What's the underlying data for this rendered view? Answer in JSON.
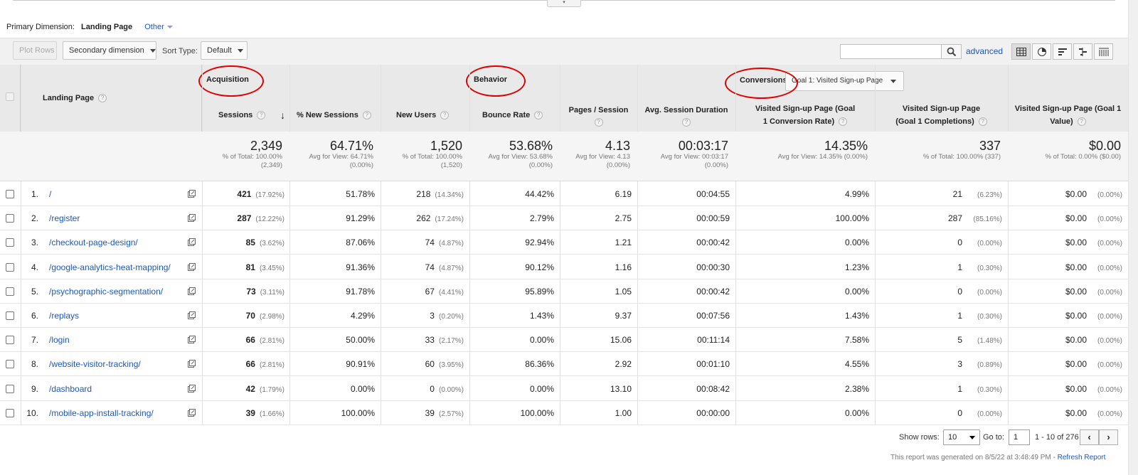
{
  "primary_dimension": {
    "label": "Primary Dimension:",
    "value": "Landing Page",
    "other": "Other"
  },
  "toolbar": {
    "plot_rows": "Plot Rows",
    "secondary_dimension": "Secondary dimension",
    "sort_type_label": "Sort Type:",
    "sort_type_value": "Default",
    "search_value": "",
    "advanced": "advanced"
  },
  "view_icons": [
    "grid-view-icon",
    "pie-view-icon",
    "bar-view-icon",
    "comparison-view-icon",
    "pivot-view-icon"
  ],
  "header": {
    "landing_page": "Landing Page",
    "groups": {
      "acquisition": "Acquisition",
      "behavior": "Behavior",
      "conversions": "Conversions",
      "goal_select": "Goal 1: Visited Sign-up Page"
    },
    "columns": {
      "sessions": "Sessions",
      "new_sessions": "% New Sessions",
      "new_users": "New Users",
      "bounce_rate": "Bounce Rate",
      "pages_session": "Pages / Session",
      "avg_duration": "Avg. Session Duration",
      "conv_rate": "Visited Sign-up Page (Goal 1 Conversion Rate)",
      "completions": "Visited Sign-up Page (Goal 1 Completions)",
      "value": "Visited Sign-up Page (Goal 1 Value)"
    }
  },
  "totals": {
    "sessions": {
      "big": "2,349",
      "sub1": "% of Total: 100.00%",
      "sub2": "(2,349)"
    },
    "new_sessions": {
      "big": "64.71%",
      "sub1": "Avg for View: 64.71%",
      "sub2": "(0.00%)"
    },
    "new_users": {
      "big": "1,520",
      "sub1": "% of Total: 100.00%",
      "sub2": "(1,520)"
    },
    "bounce_rate": {
      "big": "53.68%",
      "sub1": "Avg for View: 53.68%",
      "sub2": "(0.00%)"
    },
    "pages_session": {
      "big": "4.13",
      "sub1": "Avg for View: 4.13",
      "sub2": "(0.00%)"
    },
    "avg_duration": {
      "big": "00:03:17",
      "sub1": "Avg for View: 00:03:17",
      "sub2": "(0.00%)"
    },
    "conv_rate": {
      "big": "14.35%",
      "sub1": "Avg for View: 14.35% (0.00%)",
      "sub2": ""
    },
    "completions": {
      "big": "337",
      "sub1": "% of Total: 100.00% (337)",
      "sub2": ""
    },
    "value": {
      "big": "$0.00",
      "sub1": "% of Total: 0.00% ($0.00)",
      "sub2": ""
    }
  },
  "rows": [
    {
      "index": "1.",
      "page": "/",
      "sessions": "421",
      "sessions_pct": "(17.92%)",
      "new_sessions": "51.78%",
      "new_users": "218",
      "new_users_pct": "(14.34%)",
      "bounce": "44.42%",
      "pages": "6.19",
      "duration": "00:04:55",
      "conv_rate": "4.99%",
      "completions": "21",
      "completions_pct": "(6.23%)",
      "value": "$0.00",
      "value_pct": "(0.00%)"
    },
    {
      "index": "2.",
      "page": "/register",
      "sessions": "287",
      "sessions_pct": "(12.22%)",
      "new_sessions": "91.29%",
      "new_users": "262",
      "new_users_pct": "(17.24%)",
      "bounce": "2.79%",
      "pages": "2.75",
      "duration": "00:00:59",
      "conv_rate": "100.00%",
      "completions": "287",
      "completions_pct": "(85.16%)",
      "value": "$0.00",
      "value_pct": "(0.00%)"
    },
    {
      "index": "3.",
      "page": "/checkout-page-design/",
      "sessions": "85",
      "sessions_pct": "(3.62%)",
      "new_sessions": "87.06%",
      "new_users": "74",
      "new_users_pct": "(4.87%)",
      "bounce": "92.94%",
      "pages": "1.21",
      "duration": "00:00:42",
      "conv_rate": "0.00%",
      "completions": "0",
      "completions_pct": "(0.00%)",
      "value": "$0.00",
      "value_pct": "(0.00%)"
    },
    {
      "index": "4.",
      "page": "/google-analytics-heat-mapping/",
      "sessions": "81",
      "sessions_pct": "(3.45%)",
      "new_sessions": "91.36%",
      "new_users": "74",
      "new_users_pct": "(4.87%)",
      "bounce": "90.12%",
      "pages": "1.16",
      "duration": "00:00:30",
      "conv_rate": "1.23%",
      "completions": "1",
      "completions_pct": "(0.30%)",
      "value": "$0.00",
      "value_pct": "(0.00%)"
    },
    {
      "index": "5.",
      "page": "/psychographic-segmentation/",
      "sessions": "73",
      "sessions_pct": "(3.11%)",
      "new_sessions": "91.78%",
      "new_users": "67",
      "new_users_pct": "(4.41%)",
      "bounce": "95.89%",
      "pages": "1.05",
      "duration": "00:00:42",
      "conv_rate": "0.00%",
      "completions": "0",
      "completions_pct": "(0.00%)",
      "value": "$0.00",
      "value_pct": "(0.00%)"
    },
    {
      "index": "6.",
      "page": "/replays",
      "sessions": "70",
      "sessions_pct": "(2.98%)",
      "new_sessions": "4.29%",
      "new_users": "3",
      "new_users_pct": "(0.20%)",
      "bounce": "1.43%",
      "pages": "9.37",
      "duration": "00:07:56",
      "conv_rate": "1.43%",
      "completions": "1",
      "completions_pct": "(0.30%)",
      "value": "$0.00",
      "value_pct": "(0.00%)"
    },
    {
      "index": "7.",
      "page": "/login",
      "sessions": "66",
      "sessions_pct": "(2.81%)",
      "new_sessions": "50.00%",
      "new_users": "33",
      "new_users_pct": "(2.17%)",
      "bounce": "0.00%",
      "pages": "15.06",
      "duration": "00:11:14",
      "conv_rate": "7.58%",
      "completions": "5",
      "completions_pct": "(1.48%)",
      "value": "$0.00",
      "value_pct": "(0.00%)"
    },
    {
      "index": "8.",
      "page": "/website-visitor-tracking/",
      "sessions": "66",
      "sessions_pct": "(2.81%)",
      "new_sessions": "90.91%",
      "new_users": "60",
      "new_users_pct": "(3.95%)",
      "bounce": "86.36%",
      "pages": "2.92",
      "duration": "00:01:10",
      "conv_rate": "4.55%",
      "completions": "3",
      "completions_pct": "(0.89%)",
      "value": "$0.00",
      "value_pct": "(0.00%)"
    },
    {
      "index": "9.",
      "page": "/dashboard",
      "sessions": "42",
      "sessions_pct": "(1.79%)",
      "new_sessions": "0.00%",
      "new_users": "0",
      "new_users_pct": "(0.00%)",
      "bounce": "0.00%",
      "pages": "13.10",
      "duration": "00:08:42",
      "conv_rate": "2.38%",
      "completions": "1",
      "completions_pct": "(0.30%)",
      "value": "$0.00",
      "value_pct": "(0.00%)"
    },
    {
      "index": "10.",
      "page": "/mobile-app-install-tracking/",
      "sessions": "39",
      "sessions_pct": "(1.66%)",
      "new_sessions": "100.00%",
      "new_users": "39",
      "new_users_pct": "(2.57%)",
      "bounce": "100.00%",
      "pages": "1.00",
      "duration": "00:00:00",
      "conv_rate": "0.00%",
      "completions": "0",
      "completions_pct": "(0.00%)",
      "value": "$0.00",
      "value_pct": "(0.00%)"
    }
  ],
  "footer": {
    "show_rows_label": "Show rows:",
    "show_rows_value": "10",
    "goto_label": "Go to:",
    "goto_value": "1",
    "range": "1 - 10 of 276",
    "prev": "‹",
    "next": "›",
    "generated": "This report was generated on 8/5/22 at 3:48:49 PM - ",
    "refresh": "Refresh Report"
  },
  "colors": {
    "link": "#1a56c4",
    "highlight": "#e00000",
    "header_bg": "#e9e9e9"
  }
}
